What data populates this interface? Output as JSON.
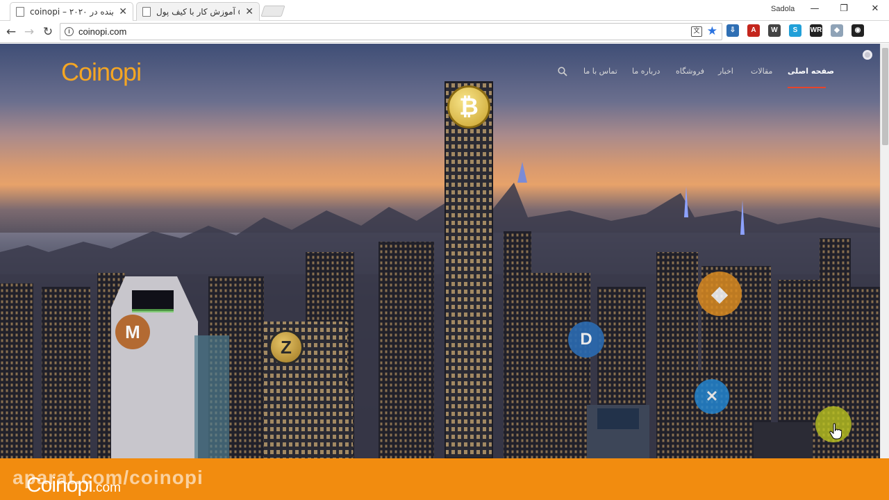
{
  "browser": {
    "tabs": [
      {
        "title": "coinopi – آینده در ۲۰۲۰",
        "active": true
      },
      {
        "title": "آموزش کار با کیف پول opi",
        "active": false
      }
    ],
    "user": "Sadola",
    "window_buttons": {
      "minimize": "—",
      "restore": "❐",
      "close": "✕"
    },
    "nav": {
      "back": "←",
      "forward": "→",
      "reload": "↻"
    },
    "address": {
      "url": "coinopi.com",
      "info_icon": "i",
      "translate_icon": "文",
      "bookmark_icon": "★"
    },
    "extensions": [
      {
        "name": "download-ext-icon",
        "label": "⇩",
        "color": "#2f6fb4"
      },
      {
        "name": "pdf-ext-icon",
        "label": "A",
        "color": "#c4261d"
      },
      {
        "name": "wordpress-ext-icon",
        "label": "W",
        "color": "#444444"
      },
      {
        "name": "stylish-ext-icon",
        "label": "S",
        "color": "#21a0d8"
      },
      {
        "name": "wr-ext-icon",
        "label": "WR",
        "color": "#222222"
      },
      {
        "name": "cloud-ext-icon",
        "label": "◆",
        "color": "#8fa3b7"
      },
      {
        "name": "ghost-ext-icon",
        "label": "◉",
        "color": "#222222"
      }
    ],
    "menu_icon": "⋮"
  },
  "site": {
    "logo": "Coinopi",
    "nav_items": [
      {
        "label": "صفحه اصلی",
        "active": true
      },
      {
        "label": "مقالات"
      },
      {
        "label": "اخبار"
      },
      {
        "label": "فروشگاه"
      },
      {
        "label": "درباره ما"
      },
      {
        "label": "تماس با ما"
      }
    ],
    "coins": [
      {
        "name": "bitcoin-icon",
        "symbol": "₿",
        "color": "#d4b13a"
      },
      {
        "name": "monero-icon",
        "symbol": "M",
        "color": "#b05a18"
      },
      {
        "name": "zcash-icon",
        "symbol": "Z",
        "color": "#b0892b"
      },
      {
        "name": "dash-icon",
        "symbol": "D",
        "color": "#2a6bb2"
      },
      {
        "name": "ethereum-icon",
        "symbol": "◆",
        "color": "#d98a21"
      },
      {
        "name": "ripple-icon",
        "symbol": "✕",
        "color": "#2384cf"
      }
    ]
  },
  "banner": {
    "watermark": "aparat.com/coinopi",
    "logo_text": "Coinopi",
    "logo_suffix": ".com"
  },
  "colors": {
    "accent": "#f5a623",
    "banner": "#f28c0f",
    "nav_underline": "#e8442b"
  }
}
